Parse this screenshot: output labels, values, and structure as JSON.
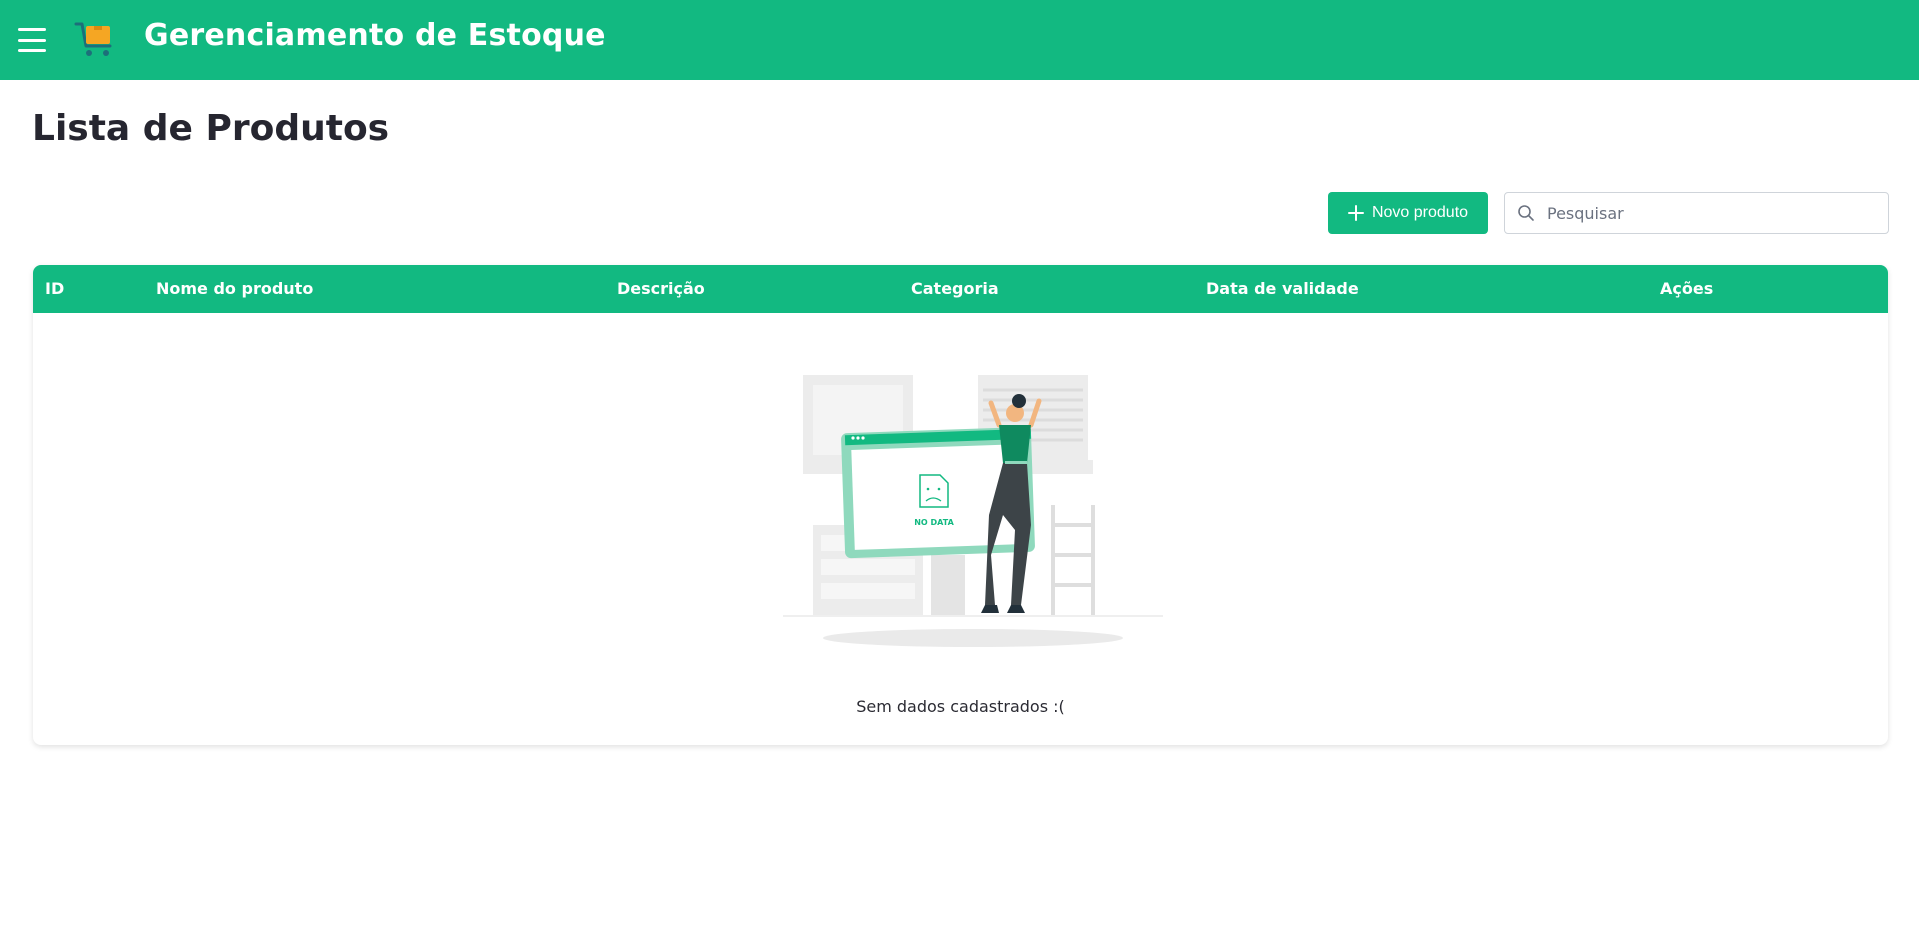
{
  "header": {
    "title": "Gerenciamento de Estoque",
    "menu_icon": "hamburger-icon",
    "logo_icon": "shopping-cart-icon",
    "brand_color": "#12b981"
  },
  "page": {
    "title": "Lista de Produtos"
  },
  "toolbar": {
    "new_label": "Novo produto",
    "search_placeholder": "Pesquisar"
  },
  "table": {
    "columns": [
      "ID",
      "Nome do produto",
      "Descrição",
      "Categoria",
      "Data de validade",
      "Ações"
    ],
    "rows": [],
    "empty_illustration_text": "NO DATA",
    "empty_message": "Sem dados cadastrados :("
  }
}
